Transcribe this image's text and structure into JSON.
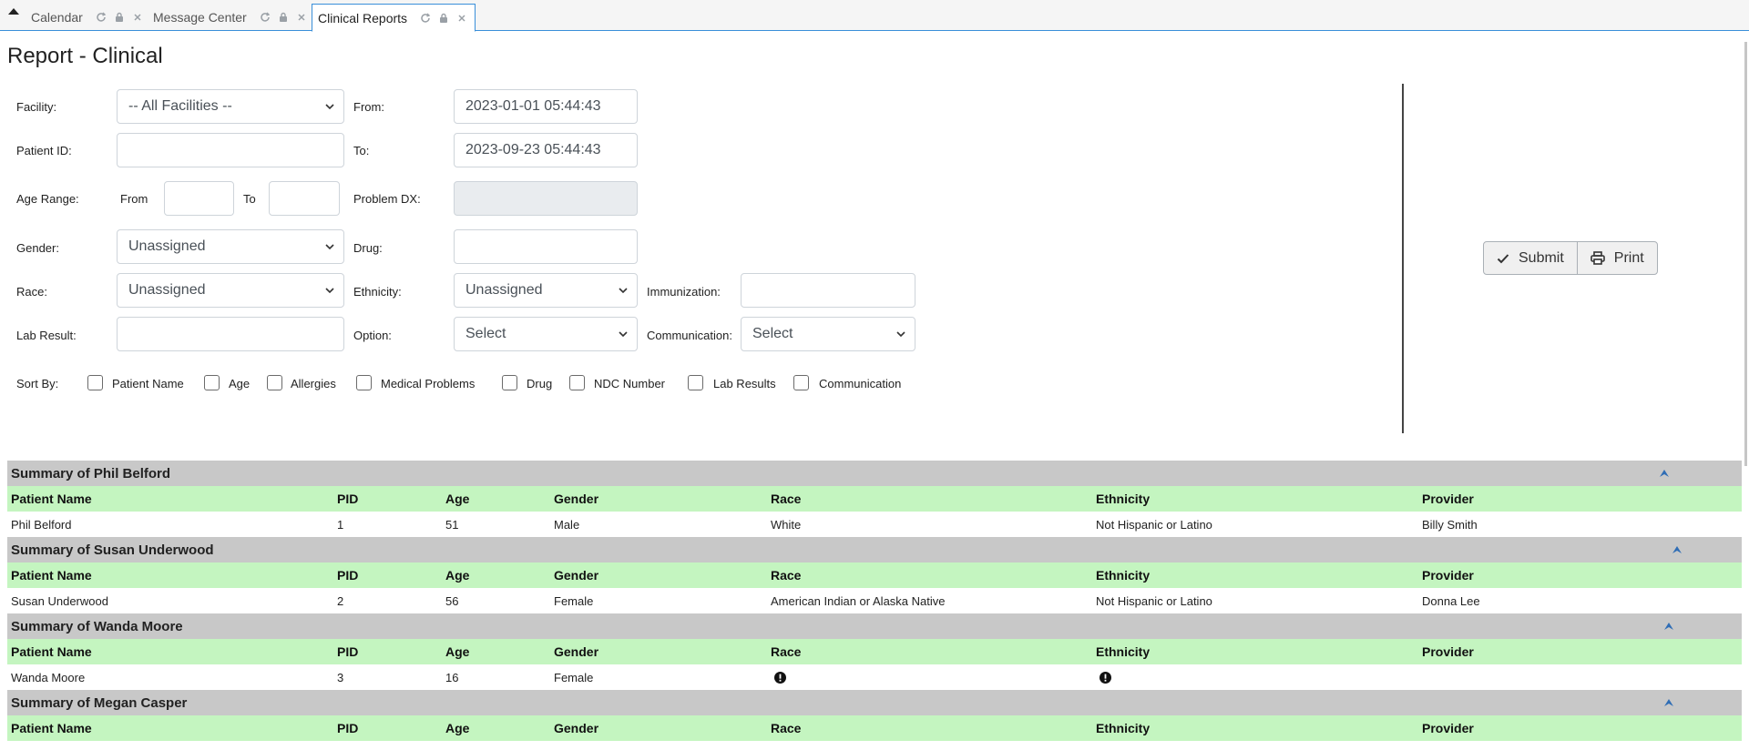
{
  "tabs": [
    {
      "label": "Calendar",
      "active": false
    },
    {
      "label": "Message Center",
      "active": false
    },
    {
      "label": "Clinical Reports",
      "active": true
    }
  ],
  "page": {
    "title": "Report - Clinical"
  },
  "form": {
    "facility_label": "Facility:",
    "facility_value": "-- All Facilities --",
    "from_label": "From:",
    "from_value": "2023-01-01 05:44:43",
    "patient_id_label": "Patient ID:",
    "patient_id_value": "",
    "to_label": "To:",
    "to_value": "2023-09-23 05:44:43",
    "age_range_label": "Age Range:",
    "age_from_label": "From",
    "age_to_label": "To",
    "problem_dx_label": "Problem DX:",
    "gender_label": "Gender:",
    "gender_value": "Unassigned",
    "drug_label": "Drug:",
    "race_label": "Race:",
    "race_value": "Unassigned",
    "ethnicity_label": "Ethnicity:",
    "ethnicity_value": "Unassigned",
    "immunization_label": "Immunization:",
    "lab_result_label": "Lab Result:",
    "option_label": "Option:",
    "option_value": "Select",
    "communication_label": "Communication:",
    "communication_value": "Select",
    "sort_by_label": "Sort By:",
    "sort_options": [
      "Patient Name",
      "Age",
      "Allergies",
      "Medical Problems",
      "Drug",
      "NDC Number",
      "Lab Results",
      "Communication"
    ]
  },
  "buttons": {
    "submit": "Submit",
    "print": "Print"
  },
  "columns": [
    "Patient Name",
    "PID",
    "Age",
    "Gender",
    "Race",
    "Ethnicity",
    "Provider"
  ],
  "summaries": [
    {
      "title": "Summary of Phil Belford",
      "row": [
        "Phil Belford",
        "1",
        "51",
        "Male",
        "White",
        "Not Hispanic or Latino",
        "Billy Smith"
      ]
    },
    {
      "title": "Summary of Susan Underwood",
      "row": [
        "Susan Underwood",
        "2",
        "56",
        "Female",
        "American Indian or Alaska Native",
        "Not Hispanic or Latino",
        "Donna Lee"
      ]
    },
    {
      "title": "Summary of Wanda Moore",
      "row": [
        "Wanda Moore",
        "3",
        "16",
        "Female",
        "",
        "",
        ""
      ]
    },
    {
      "title": "Summary of Megan Casper",
      "row": null
    }
  ],
  "icons": {
    "tab_refresh": "refresh-icon",
    "tab_lock": "lock-icon",
    "tab_close": "close-icon",
    "submit": "check-icon",
    "print": "printer-icon",
    "collapse": "chevron-up-icon",
    "missing": "exclamation-circle-icon"
  },
  "colors": {
    "tab_accent": "#3a8fd9",
    "summary_header": "#c8c8c8",
    "column_header": "#c4f5c0",
    "collapse_icon": "#2f6db5"
  }
}
